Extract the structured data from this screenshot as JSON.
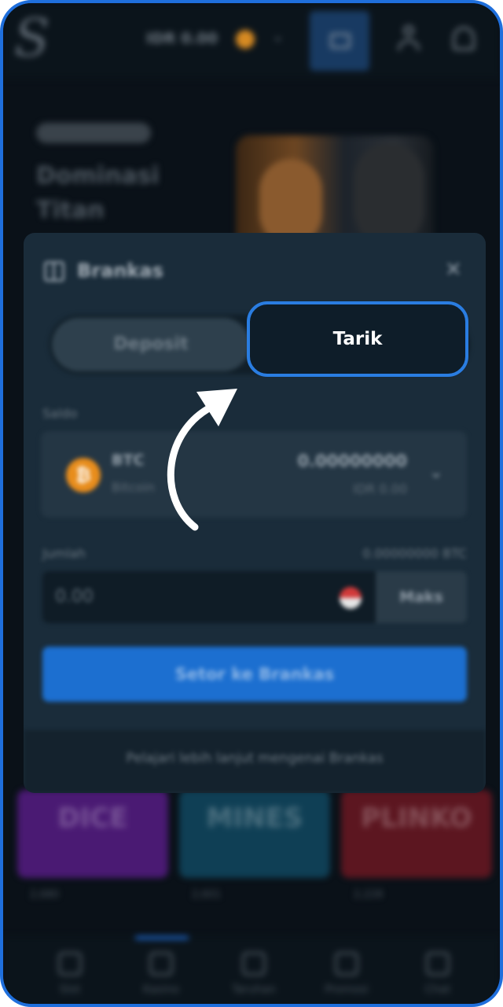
{
  "app": {
    "logo_letter": "S",
    "balance": "IDR 0.00",
    "promo_title": [
      "Dominasi",
      "Titan"
    ]
  },
  "games": [
    {
      "name": "DICE",
      "stat": "2,680"
    },
    {
      "name": "MINES",
      "stat": "2,601"
    },
    {
      "name": "PLINKO",
      "stat": "2,228"
    }
  ],
  "bottom_nav": [
    "Slot",
    "Kasino",
    "Taruhan",
    "Promosi",
    "Chat"
  ],
  "vault": {
    "title": "Brankas",
    "tabs": {
      "deposit": "Deposit",
      "withdraw": "Tarik"
    },
    "balance_label": "Saldo",
    "coin": {
      "code": "BTC",
      "name": "Bitcoin",
      "amount": "0.00000000",
      "idr": "IDR 0.00"
    },
    "amount_label": "Jumlah",
    "amount_max": "0.00000000 BTC",
    "amount_placeholder": "0.00",
    "max_button": "Maks",
    "submit_button": "Setor ke Brankas",
    "footer_link": "Pelajari lebih lanjut mengenai Brankas"
  },
  "colors": {
    "accent": "#1f6fdc",
    "highlight": "#2a7de1",
    "coin": "#e88d1c"
  }
}
